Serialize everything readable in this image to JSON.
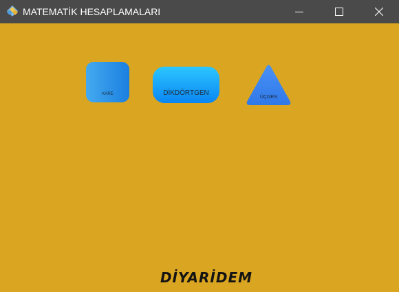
{
  "window": {
    "title": "MATEMATİK HESAPLAMALARI",
    "background_color": "#DAA520",
    "titlebar_color": "#4a4a4a",
    "controls": {
      "minimize_icon": "minimize-icon",
      "maximize_icon": "maximize-icon",
      "close_icon": "close-icon"
    }
  },
  "shapes": {
    "kare": {
      "label": "KARE",
      "color": "#1a7fe0"
    },
    "dikdortgen": {
      "label": "DİKDÖRTGEN",
      "color": "#0a86f3"
    },
    "ucgen": {
      "label": "ÜÇGEN",
      "color": "#3b84f0"
    }
  },
  "footer": {
    "brand": "DİYARİDEM"
  }
}
